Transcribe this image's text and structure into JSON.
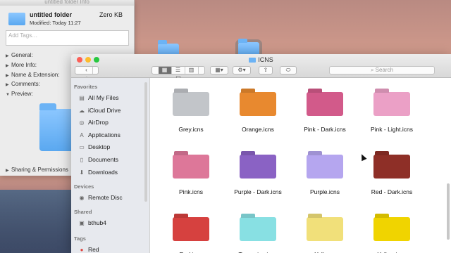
{
  "info_window": {
    "title": "untitled folder Info",
    "name": "untitled folder",
    "size": "Zero KB",
    "modified": "Modified: Today 11:27",
    "tags_placeholder": "Add Tags…",
    "sections": [
      "General:",
      "More Info:",
      "Name & Extension:",
      "Comments:",
      "Preview:"
    ],
    "footer": "Sharing & Permissions"
  },
  "finder": {
    "title": "ICNS",
    "search_placeholder": "Search",
    "sidebar": {
      "favorites_header": "Favorites",
      "favorites": [
        {
          "label": "All My Files",
          "icon": "all-files-icon"
        },
        {
          "label": "iCloud Drive",
          "icon": "cloud-icon"
        },
        {
          "label": "AirDrop",
          "icon": "airdrop-icon"
        },
        {
          "label": "Applications",
          "icon": "applications-icon"
        },
        {
          "label": "Desktop",
          "icon": "desktop-icon"
        },
        {
          "label": "Documents",
          "icon": "documents-icon"
        },
        {
          "label": "Downloads",
          "icon": "downloads-icon"
        }
      ],
      "devices_header": "Devices",
      "devices": [
        {
          "label": "Remote Disc",
          "icon": "disc-icon"
        }
      ],
      "shared_header": "Shared",
      "shared": [
        {
          "label": "bthub4",
          "icon": "display-icon"
        }
      ],
      "tags_header": "Tags",
      "tags": [
        {
          "label": "Red",
          "color": "#e0453f"
        }
      ]
    },
    "files": [
      {
        "name": "Grey.icns",
        "color": "#c2c5c9"
      },
      {
        "name": "Orange.icns",
        "color": "#e8892f"
      },
      {
        "name": "Pink - Dark.icns",
        "color": "#d25a8a"
      },
      {
        "name": "Pink - Light.icns",
        "color": "#eba0c6"
      },
      {
        "name": "Pink.icns",
        "color": "#dd7799"
      },
      {
        "name": "Purple - Dark.icns",
        "color": "#8a62c4"
      },
      {
        "name": "Purple.icns",
        "color": "#b5a6ef"
      },
      {
        "name": "Red - Dark.icns",
        "color": "#8e2f27"
      },
      {
        "name": "Red.icns",
        "color": "#d6413f"
      },
      {
        "name": "Turquoise.icns",
        "color": "#88e0e3"
      },
      {
        "name": "Yellow -",
        "color": "#f1e07a"
      },
      {
        "name": "Yellow.icns",
        "color": "#f0d400"
      }
    ]
  }
}
